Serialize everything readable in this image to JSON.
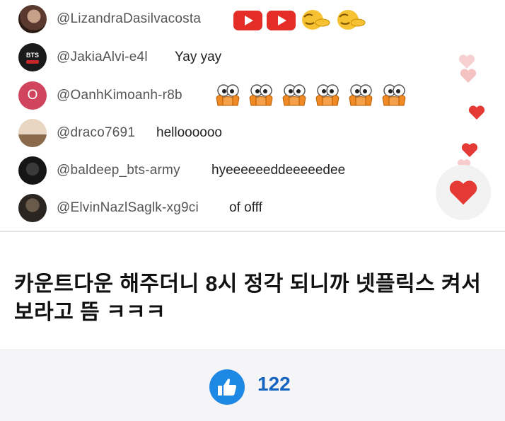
{
  "comments": [
    {
      "username": "@LizandraDasilvacosta",
      "message": "",
      "emoji": [
        "youtube-icon",
        "youtube-icon",
        "shush-face-icon",
        "shush-face-icon"
      ]
    },
    {
      "username": "@JakiaAlvi-e4l",
      "message": "Yay yay",
      "avatar_text": "BTS"
    },
    {
      "username": "@OanhKimoanh-r8b",
      "message": "",
      "avatar_text": "O",
      "emoji": [
        "peek-eyes-icon",
        "peek-eyes-icon",
        "peek-eyes-icon",
        "peek-eyes-icon",
        "peek-eyes-icon",
        "peek-eyes-icon"
      ]
    },
    {
      "username": "@draco7691",
      "message": "helloooooo"
    },
    {
      "username": "@baldeep_bts-army",
      "message": "hyeeeeeeddeeeeedee"
    },
    {
      "username": "@ElvinNazlSaglk-xg9ci",
      "message": "of offf"
    }
  ],
  "post": {
    "line1": "카운트다운 해주더니 8시 정각 되니까 넷플릭스 켜서",
    "line2": "보라고 뜸 ㅋㅋㅋ"
  },
  "like": {
    "count": "122"
  },
  "colors": {
    "youtube_red": "#e52d27",
    "like_blue": "#1e88e5",
    "heart_red": "#e53935"
  }
}
